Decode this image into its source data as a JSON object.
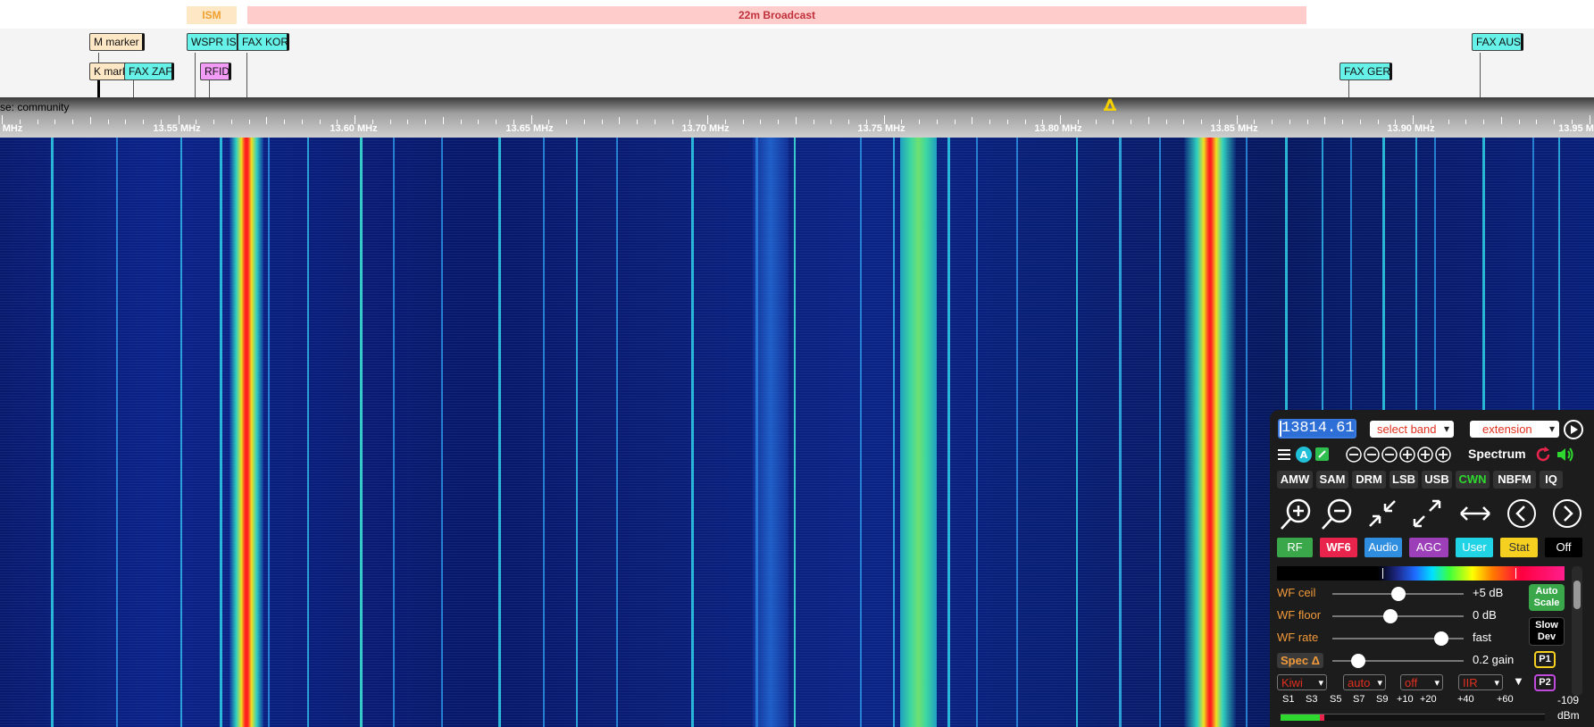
{
  "bands": [
    {
      "label": "ISM",
      "bg": "#fde7c5",
      "color": "#f0a030"
    },
    {
      "label": "22m Broadcast",
      "bg": "#ffcccc",
      "color": "#c0303a"
    }
  ],
  "labels": [
    {
      "text": "M marker",
      "bg": "#fde7c5"
    },
    {
      "text": "K marker",
      "bg": "#fde7c5"
    },
    {
      "text": "FAX ZAF",
      "bg": "#66f2e8"
    },
    {
      "text": "WSPR ISM",
      "bg": "#66f2e8"
    },
    {
      "text": "FAX KOR",
      "bg": "#66f2e8"
    },
    {
      "text": "RFID",
      "bg": "#f39cf7"
    },
    {
      "text": "FAX GER",
      "bg": "#66f2e8"
    },
    {
      "text": "FAX AUS",
      "bg": "#66f2e8"
    }
  ],
  "scale": {
    "name": "se: community",
    "ticks": [
      "MHz",
      "13.55 MHz",
      "13.60 MHz",
      "13.65 MHz",
      "13.70 MHz",
      "13.75 MHz",
      "13.80 MHz",
      "13.85 MHz",
      "13.90 MHz",
      "13.95 M"
    ]
  },
  "panel": {
    "frequency": "13814.61",
    "select_band": "select band",
    "extension": "extension",
    "spectrum_label": "Spectrum",
    "modes": [
      "AMW",
      "SAM",
      "DRM",
      "LSB",
      "USB",
      "CWN",
      "NBFM",
      "IQ"
    ],
    "active_mode": "CWN",
    "tabs": [
      {
        "label": "RF",
        "bg": "#3aa84a",
        "color": "#ffffff"
      },
      {
        "label": "WF6",
        "bg": "#e8244d",
        "color": "#ffffff"
      },
      {
        "label": "Audio",
        "bg": "#2f8ee0",
        "color": "#ffffff"
      },
      {
        "label": "AGC",
        "bg": "#9c3fb8",
        "color": "#ffffff"
      },
      {
        "label": "User",
        "bg": "#20d4e6",
        "color": "#ffffff"
      },
      {
        "label": "Stat",
        "bg": "#f5d020",
        "color": "#333333"
      },
      {
        "label": "Off",
        "bg": "#000000",
        "color": "#ffffff"
      }
    ],
    "sliders": [
      {
        "label": "WF ceil",
        "value": "+5 dB",
        "level": 0.5
      },
      {
        "label": "WF floor",
        "value": "0 dB",
        "level": 0.44
      },
      {
        "label": "WF rate",
        "value": "fast",
        "level": 0.83
      },
      {
        "label": "Spec Δ",
        "value": "0.2 gain",
        "level": 0.2
      }
    ],
    "side_buttons": {
      "auto_scale": "Auto Scale",
      "slow_dev": "Slow Dev",
      "p1": "P1",
      "p2": "P2"
    },
    "bottom_selects": [
      "Kiwi",
      "auto",
      "off",
      "IIR"
    ],
    "smeter_labels": [
      "S1",
      "S3",
      "S5",
      "S7",
      "S9",
      "+10",
      "+20",
      "+40",
      "+60"
    ],
    "smeter_value": "-109",
    "smeter_unit": "dBm",
    "smeter_level": 0.16
  }
}
